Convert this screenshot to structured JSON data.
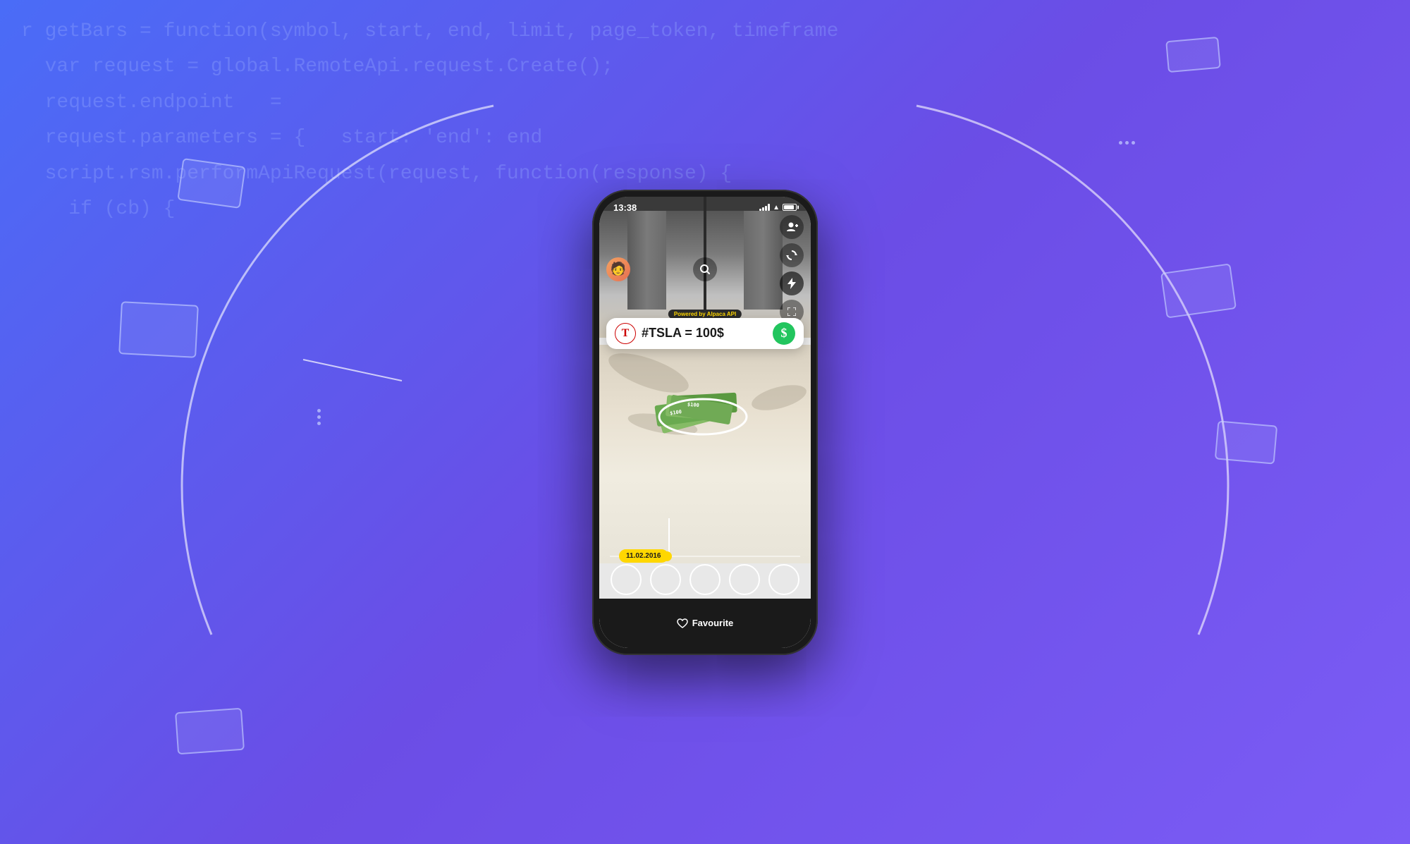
{
  "bg_code": {
    "lines": [
      "r getBars = function(symbol, start, end, limit, page_token, timeframe",
      "  var request = global.RemoteApi.request.Create();",
      "  request.endpoint   =",
      "  request.parameters = {   start: 'end': end",
      "  script.rsm.performApiRequest(request, function(response) {",
      "    if (cb) {"
    ]
  },
  "phone": {
    "status": {
      "time": "13:38",
      "signal": "full",
      "wifi": true,
      "battery": "full"
    },
    "powered_badge": "Powered by Alpaca API",
    "stock_widget": {
      "hashtag_text": "#TSLA = 100$",
      "brand": "Tesla"
    },
    "date_tag": "11.02.2016",
    "filter_circles_count": 5,
    "fav_button": "Favourite"
  },
  "decorations": {
    "rect1": {
      "label": "rect-top-right"
    },
    "rect2": {
      "label": "rect-left-mid"
    },
    "rect3": {
      "label": "rect-right-mid"
    },
    "rect4": {
      "label": "rect-bottom-left"
    }
  }
}
